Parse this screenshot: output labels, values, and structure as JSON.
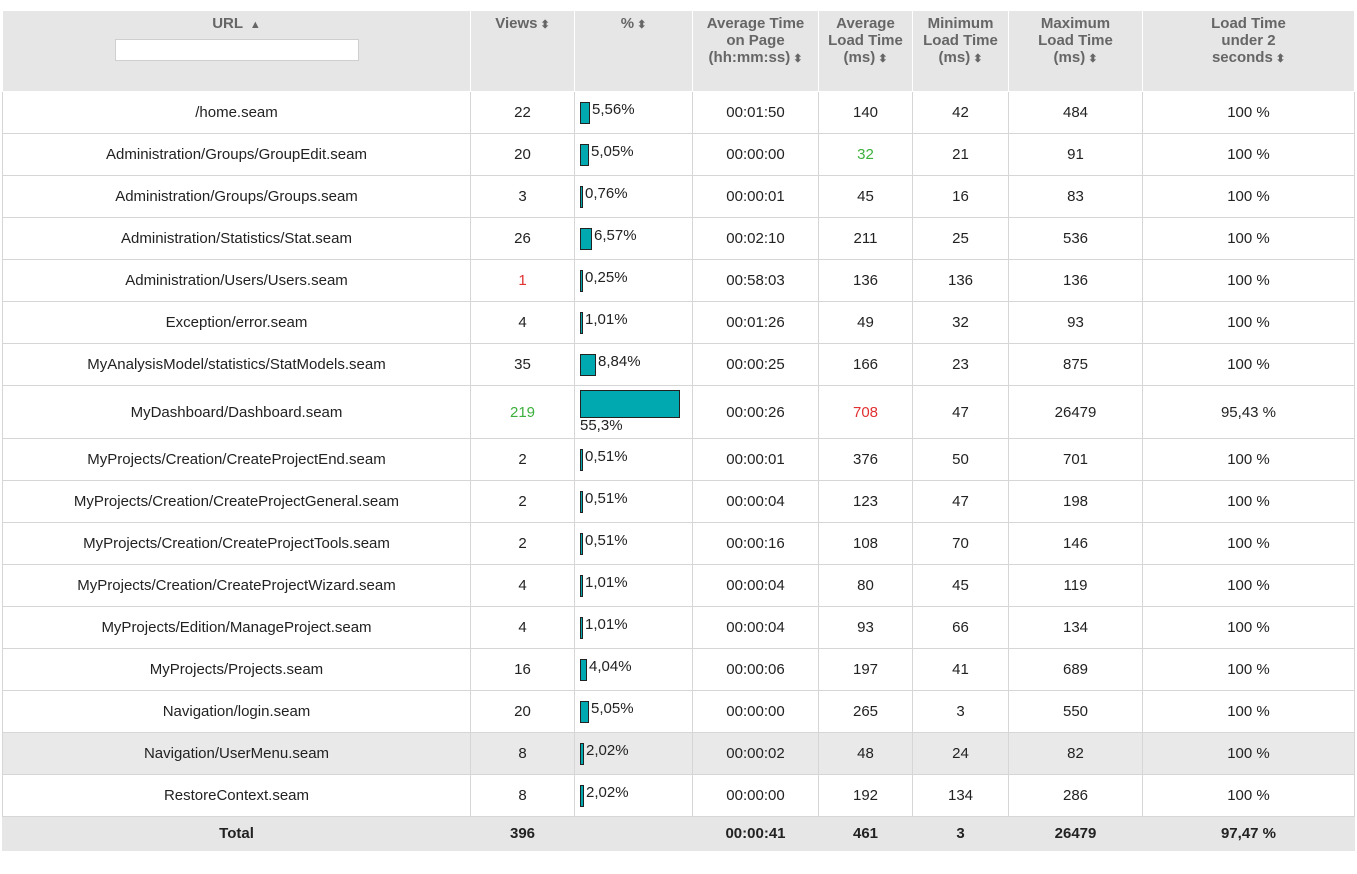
{
  "headers": {
    "url": "URL",
    "url_sort": "▲",
    "views": "Views",
    "pct": "%",
    "avg_time": "Average Time\non Page\n(hh:mm:ss)",
    "avg_load": "Average\nLoad Time\n(ms)",
    "min_load": "Minimum\nLoad Time\n(ms)",
    "max_load": "Maximum\nLoad Time\n(ms)",
    "under2": "Load Time\nunder 2\nseconds",
    "sort_glyph": "⬍"
  },
  "filter": {
    "value": "",
    "placeholder": ""
  },
  "colors": {
    "bar": "#00a8b0",
    "highlight_low": "#3cb03c",
    "highlight_high": "#e03030"
  },
  "rows": [
    {
      "url": "/home.seam",
      "views": "22",
      "pct": "5,56%",
      "pct_value": 5.56,
      "avg_time": "00:01:50",
      "avg_load": "140",
      "min_load": "42",
      "max_load": "484",
      "under2": "100 %"
    },
    {
      "url": "Administration/Groups/GroupEdit.seam",
      "views": "20",
      "pct": "5,05%",
      "pct_value": 5.05,
      "avg_time": "00:00:00",
      "avg_load": "32",
      "min_load": "21",
      "max_load": "91",
      "under2": "100 %"
    },
    {
      "url": "Administration/Groups/Groups.seam",
      "views": "3",
      "pct": "0,76%",
      "pct_value": 0.76,
      "avg_time": "00:00:01",
      "avg_load": "45",
      "min_load": "16",
      "max_load": "83",
      "under2": "100 %"
    },
    {
      "url": "Administration/Statistics/Stat.seam",
      "views": "26",
      "pct": "6,57%",
      "pct_value": 6.57,
      "avg_time": "00:02:10",
      "avg_load": "211",
      "min_load": "25",
      "max_load": "536",
      "under2": "100 %"
    },
    {
      "url": "Administration/Users/Users.seam",
      "views": "1",
      "pct": "0,25%",
      "pct_value": 0.25,
      "avg_time": "00:58:03",
      "avg_load": "136",
      "min_load": "136",
      "max_load": "136",
      "under2": "100 %"
    },
    {
      "url": "Exception/error.seam",
      "views": "4",
      "pct": "1,01%",
      "pct_value": 1.01,
      "avg_time": "00:01:26",
      "avg_load": "49",
      "min_load": "32",
      "max_load": "93",
      "under2": "100 %"
    },
    {
      "url": "MyAnalysisModel/statistics/StatModels.seam",
      "views": "35",
      "pct": "8,84%",
      "pct_value": 8.84,
      "avg_time": "00:00:25",
      "avg_load": "166",
      "min_load": "23",
      "max_load": "875",
      "under2": "100 %"
    },
    {
      "url": "MyDashboard/Dashboard.seam",
      "views": "219",
      "pct": "55,3%",
      "pct_value": 55.3,
      "avg_time": "00:00:26",
      "avg_load": "708",
      "min_load": "47",
      "max_load": "26479",
      "under2": "95,43 %"
    },
    {
      "url": "MyProjects/Creation/CreateProjectEnd.seam",
      "views": "2",
      "pct": "0,51%",
      "pct_value": 0.51,
      "avg_time": "00:00:01",
      "avg_load": "376",
      "min_load": "50",
      "max_load": "701",
      "under2": "100 %"
    },
    {
      "url": "MyProjects/Creation/CreateProjectGeneral.seam",
      "views": "2",
      "pct": "0,51%",
      "pct_value": 0.51,
      "avg_time": "00:00:04",
      "avg_load": "123",
      "min_load": "47",
      "max_load": "198",
      "under2": "100 %"
    },
    {
      "url": "MyProjects/Creation/CreateProjectTools.seam",
      "views": "2",
      "pct": "0,51%",
      "pct_value": 0.51,
      "avg_time": "00:00:16",
      "avg_load": "108",
      "min_load": "70",
      "max_load": "146",
      "under2": "100 %"
    },
    {
      "url": "MyProjects/Creation/CreateProjectWizard.seam",
      "views": "4",
      "pct": "1,01%",
      "pct_value": 1.01,
      "avg_time": "00:00:04",
      "avg_load": "80",
      "min_load": "45",
      "max_load": "119",
      "under2": "100 %"
    },
    {
      "url": "MyProjects/Edition/ManageProject.seam",
      "views": "4",
      "pct": "1,01%",
      "pct_value": 1.01,
      "avg_time": "00:00:04",
      "avg_load": "93",
      "min_load": "66",
      "max_load": "134",
      "under2": "100 %"
    },
    {
      "url": "MyProjects/Projects.seam",
      "views": "16",
      "pct": "4,04%",
      "pct_value": 4.04,
      "avg_time": "00:00:06",
      "avg_load": "197",
      "min_load": "41",
      "max_load": "689",
      "under2": "100 %"
    },
    {
      "url": "Navigation/login.seam",
      "views": "20",
      "pct": "5,05%",
      "pct_value": 5.05,
      "avg_time": "00:00:00",
      "avg_load": "265",
      "min_load": "3",
      "max_load": "550",
      "under2": "100 %"
    },
    {
      "url": "Navigation/UserMenu.seam",
      "views": "8",
      "pct": "2,02%",
      "pct_value": 2.02,
      "avg_time": "00:00:02",
      "avg_load": "48",
      "min_load": "24",
      "max_load": "82",
      "under2": "100 %"
    },
    {
      "url": "RestoreContext.seam",
      "views": "8",
      "pct": "2,02%",
      "pct_value": 2.02,
      "avg_time": "00:00:00",
      "avg_load": "192",
      "min_load": "134",
      "max_load": "286",
      "under2": "100 %"
    }
  ],
  "total": {
    "label": "Total",
    "views": "396",
    "avg_time": "00:00:41",
    "avg_load": "461",
    "min_load": "3",
    "max_load": "26479",
    "under2": "97,47 %"
  }
}
